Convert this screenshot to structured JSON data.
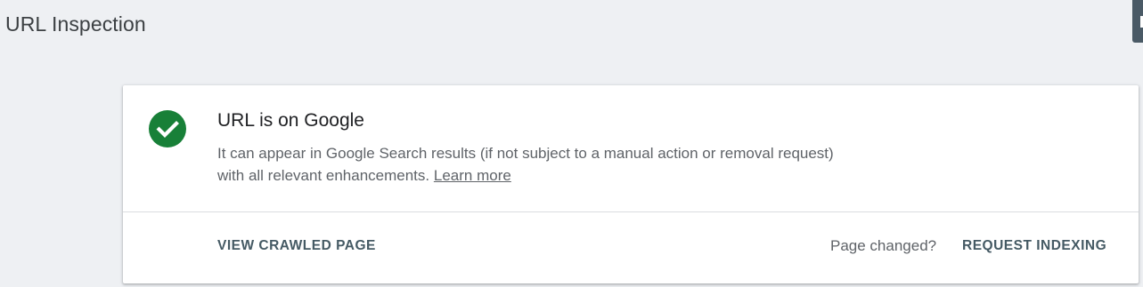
{
  "page": {
    "title": "URL Inspection"
  },
  "status_card": {
    "icon": "check-circle-icon",
    "icon_color": "#188038",
    "heading": "URL is on Google",
    "description": "It can appear in Google Search results (if not subject to a manual action or removal request) with all relevant enhancements.",
    "learn_more_label": "Learn more",
    "view_crawled_label": "VIEW CRAWLED PAGE",
    "page_changed_text": "Page changed?",
    "request_indexing_label": "REQUEST INDEXING"
  },
  "colors": {
    "background": "#eef0f3",
    "action_text": "#455a64",
    "corner_button": "#4a5a66"
  }
}
